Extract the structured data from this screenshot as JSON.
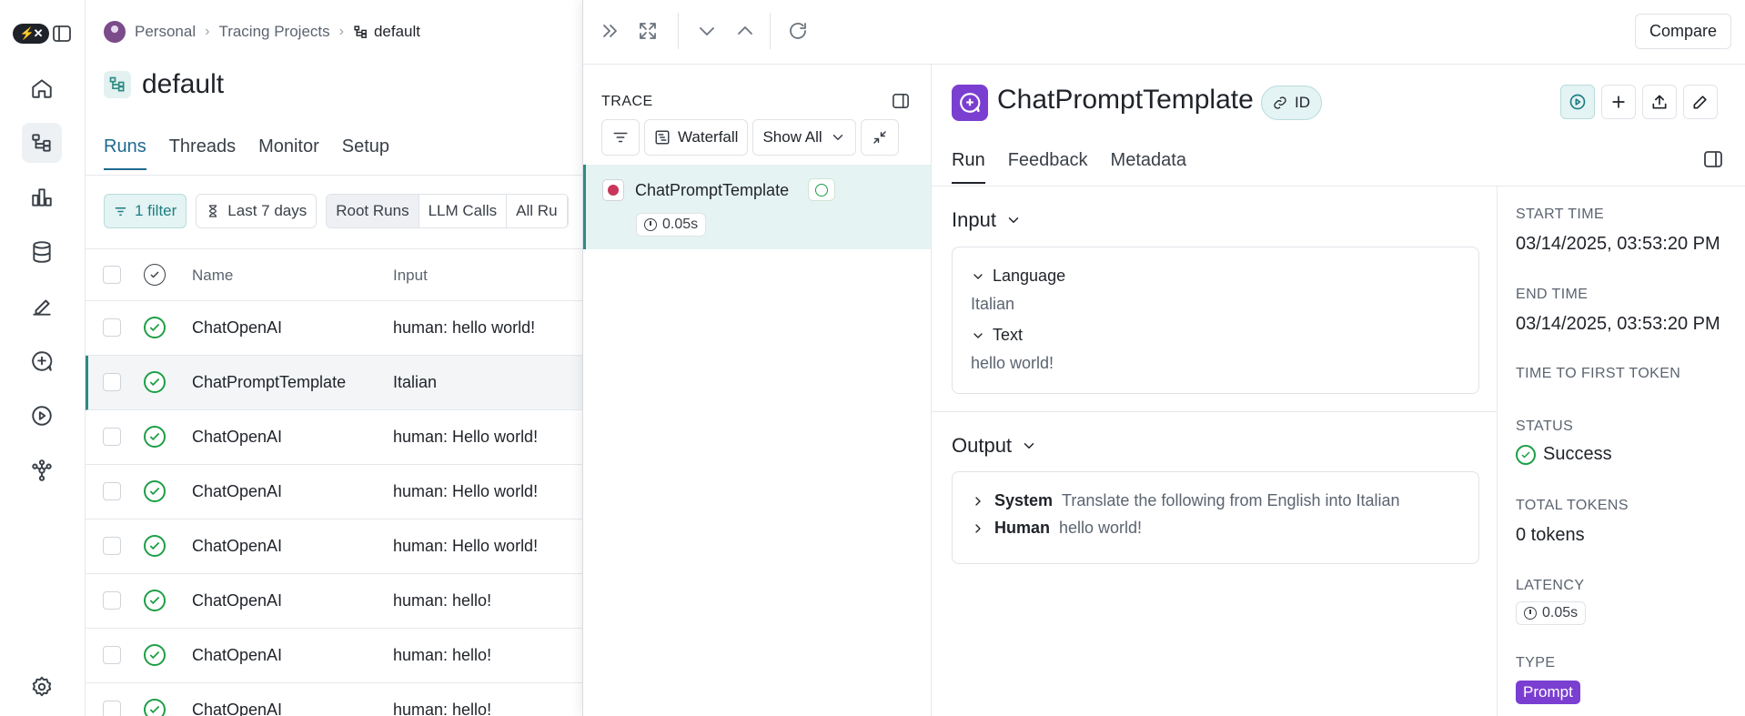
{
  "breadcrumb": {
    "workspace": "Personal",
    "section": "Tracing Projects",
    "project": "default"
  },
  "project": {
    "title": "default",
    "tabs": [
      {
        "label": "Runs",
        "active": true
      },
      {
        "label": "Threads"
      },
      {
        "label": "Monitor"
      },
      {
        "label": "Setup"
      }
    ],
    "filters": {
      "filter_chip": "1 filter",
      "time_range": "Last 7 days",
      "run_types": [
        "Root Runs",
        "LLM Calls",
        "All Ru"
      ]
    },
    "table": {
      "columns": [
        "Name",
        "Input"
      ],
      "rows": [
        {
          "name": "ChatOpenAI",
          "input": "human: hello world!",
          "status": "success"
        },
        {
          "name": "ChatPromptTemplate",
          "input": "Italian",
          "status": "success",
          "selected": true
        },
        {
          "name": "ChatOpenAI",
          "input": "human: Hello world!",
          "status": "success"
        },
        {
          "name": "ChatOpenAI",
          "input": "human: Hello world!",
          "status": "success"
        },
        {
          "name": "ChatOpenAI",
          "input": "human: Hello world!",
          "status": "success"
        },
        {
          "name": "ChatOpenAI",
          "input": "human: hello!",
          "status": "success"
        },
        {
          "name": "ChatOpenAI",
          "input": "human: hello!",
          "status": "success"
        },
        {
          "name": "ChatOpenAI",
          "input": "human: hello!",
          "status": "success"
        }
      ]
    }
  },
  "toolbar": {
    "compare_label": "Compare"
  },
  "trace": {
    "label": "TRACE",
    "view_label": "Waterfall",
    "show_label": "Show All",
    "item": {
      "name": "ChatPromptTemplate",
      "latency": "0.05s",
      "status": "success"
    }
  },
  "run": {
    "title": "ChatPromptTemplate",
    "id_label": "ID",
    "tabs": [
      {
        "label": "Run",
        "active": true
      },
      {
        "label": "Feedback"
      },
      {
        "label": "Metadata"
      }
    ],
    "input": {
      "title": "Input",
      "fields": [
        {
          "key": "Language",
          "value": "Italian"
        },
        {
          "key": "Text",
          "value": "hello world!"
        }
      ]
    },
    "output": {
      "title": "Output",
      "messages": [
        {
          "role": "System",
          "text": "Translate the following from English into Italian"
        },
        {
          "role": "Human",
          "text": "hello world!"
        }
      ]
    },
    "meta": {
      "start_time_label": "START TIME",
      "start_time": "03/14/2025, 03:53:20 PM",
      "end_time_label": "END TIME",
      "end_time": "03/14/2025, 03:53:20 PM",
      "ttft_label": "TIME TO FIRST TOKEN",
      "status_label": "STATUS",
      "status": "Success",
      "tokens_label": "TOTAL TOKENS",
      "tokens": "0 tokens",
      "latency_label": "LATENCY",
      "latency": "0.05s",
      "type_label": "TYPE",
      "type": "Prompt"
    }
  },
  "colors": {
    "accent": "#2e8b83",
    "run_type_purple": "#7a3fd1",
    "success": "#1e9e46"
  }
}
